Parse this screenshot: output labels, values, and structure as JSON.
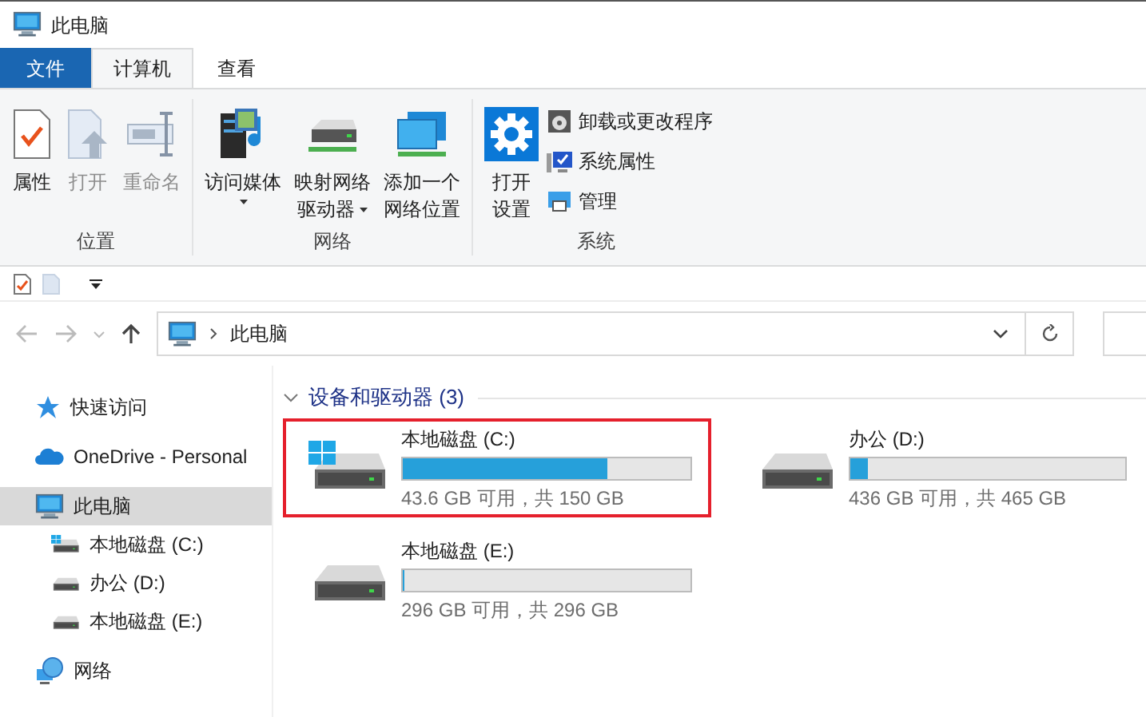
{
  "window": {
    "title": "此电脑"
  },
  "tabs": [
    {
      "label": "文件",
      "kind": "file",
      "selected": false
    },
    {
      "label": "计算机",
      "kind": "tab",
      "selected": true
    },
    {
      "label": "查看",
      "kind": "tab",
      "selected": false
    }
  ],
  "ribbon": {
    "groups": [
      {
        "label": "位置",
        "items": [
          {
            "kind": "large",
            "lines": [
              "属性"
            ],
            "disabled": false,
            "dropdown": false
          },
          {
            "kind": "large",
            "lines": [
              "打开"
            ],
            "disabled": true,
            "dropdown": false
          },
          {
            "kind": "large",
            "lines": [
              "重命名"
            ],
            "disabled": true,
            "dropdown": false
          }
        ]
      },
      {
        "label": "网络",
        "items": [
          {
            "kind": "large",
            "lines": [
              "访问媒体"
            ],
            "disabled": false,
            "dropdown": true
          },
          {
            "kind": "large",
            "lines": [
              "映射网络",
              "驱动器"
            ],
            "disabled": false,
            "dropdown": true
          },
          {
            "kind": "large",
            "lines": [
              "添加一个",
              "网络位置"
            ],
            "disabled": false,
            "dropdown": false
          }
        ]
      },
      {
        "label": "系统",
        "items": [
          {
            "kind": "large",
            "lines": [
              "打开",
              "设置"
            ],
            "disabled": false,
            "dropdown": false
          },
          {
            "kind": "small",
            "lines": [
              "卸载或更改程序"
            ],
            "disabled": false
          },
          {
            "kind": "small",
            "lines": [
              "系统属性"
            ],
            "disabled": false
          },
          {
            "kind": "small",
            "lines": [
              "管理"
            ],
            "disabled": false
          }
        ]
      }
    ]
  },
  "address": {
    "path": [
      "此电脑"
    ]
  },
  "sidebar": {
    "items": [
      {
        "label": "快速访问",
        "kind": "star",
        "selected": false
      },
      {
        "label": "OneDrive - Personal",
        "kind": "cloud",
        "selected": false
      },
      {
        "label": "此电脑",
        "kind": "pc",
        "selected": true,
        "children": [
          {
            "label": "本地磁盘 (C:)",
            "kind": "sysdrive",
            "selected": false
          },
          {
            "label": "办公 (D:)",
            "kind": "drive",
            "selected": false
          },
          {
            "label": "本地磁盘 (E:)",
            "kind": "drive",
            "selected": false
          }
        ]
      },
      {
        "label": "网络",
        "kind": "network",
        "selected": false
      }
    ]
  },
  "section": {
    "title": "设备和驱动器 (3)",
    "expanded": true
  },
  "drives": [
    {
      "name": "本地磁盘 (C:)",
      "kind": "sysdrive",
      "level": 0.71,
      "free": "43.6 GB 可用，共 150 GB",
      "highlighted": true
    },
    {
      "name": "办公 (D:)",
      "kind": "drive",
      "level": 0.064,
      "free": "436 GB 可用，共 465 GB",
      "highlighted": false
    },
    {
      "name": "本地磁盘 (E:)",
      "kind": "drive",
      "level": 0,
      "free": "296 GB 可用，共 296 GB",
      "highlighted": false
    }
  ]
}
